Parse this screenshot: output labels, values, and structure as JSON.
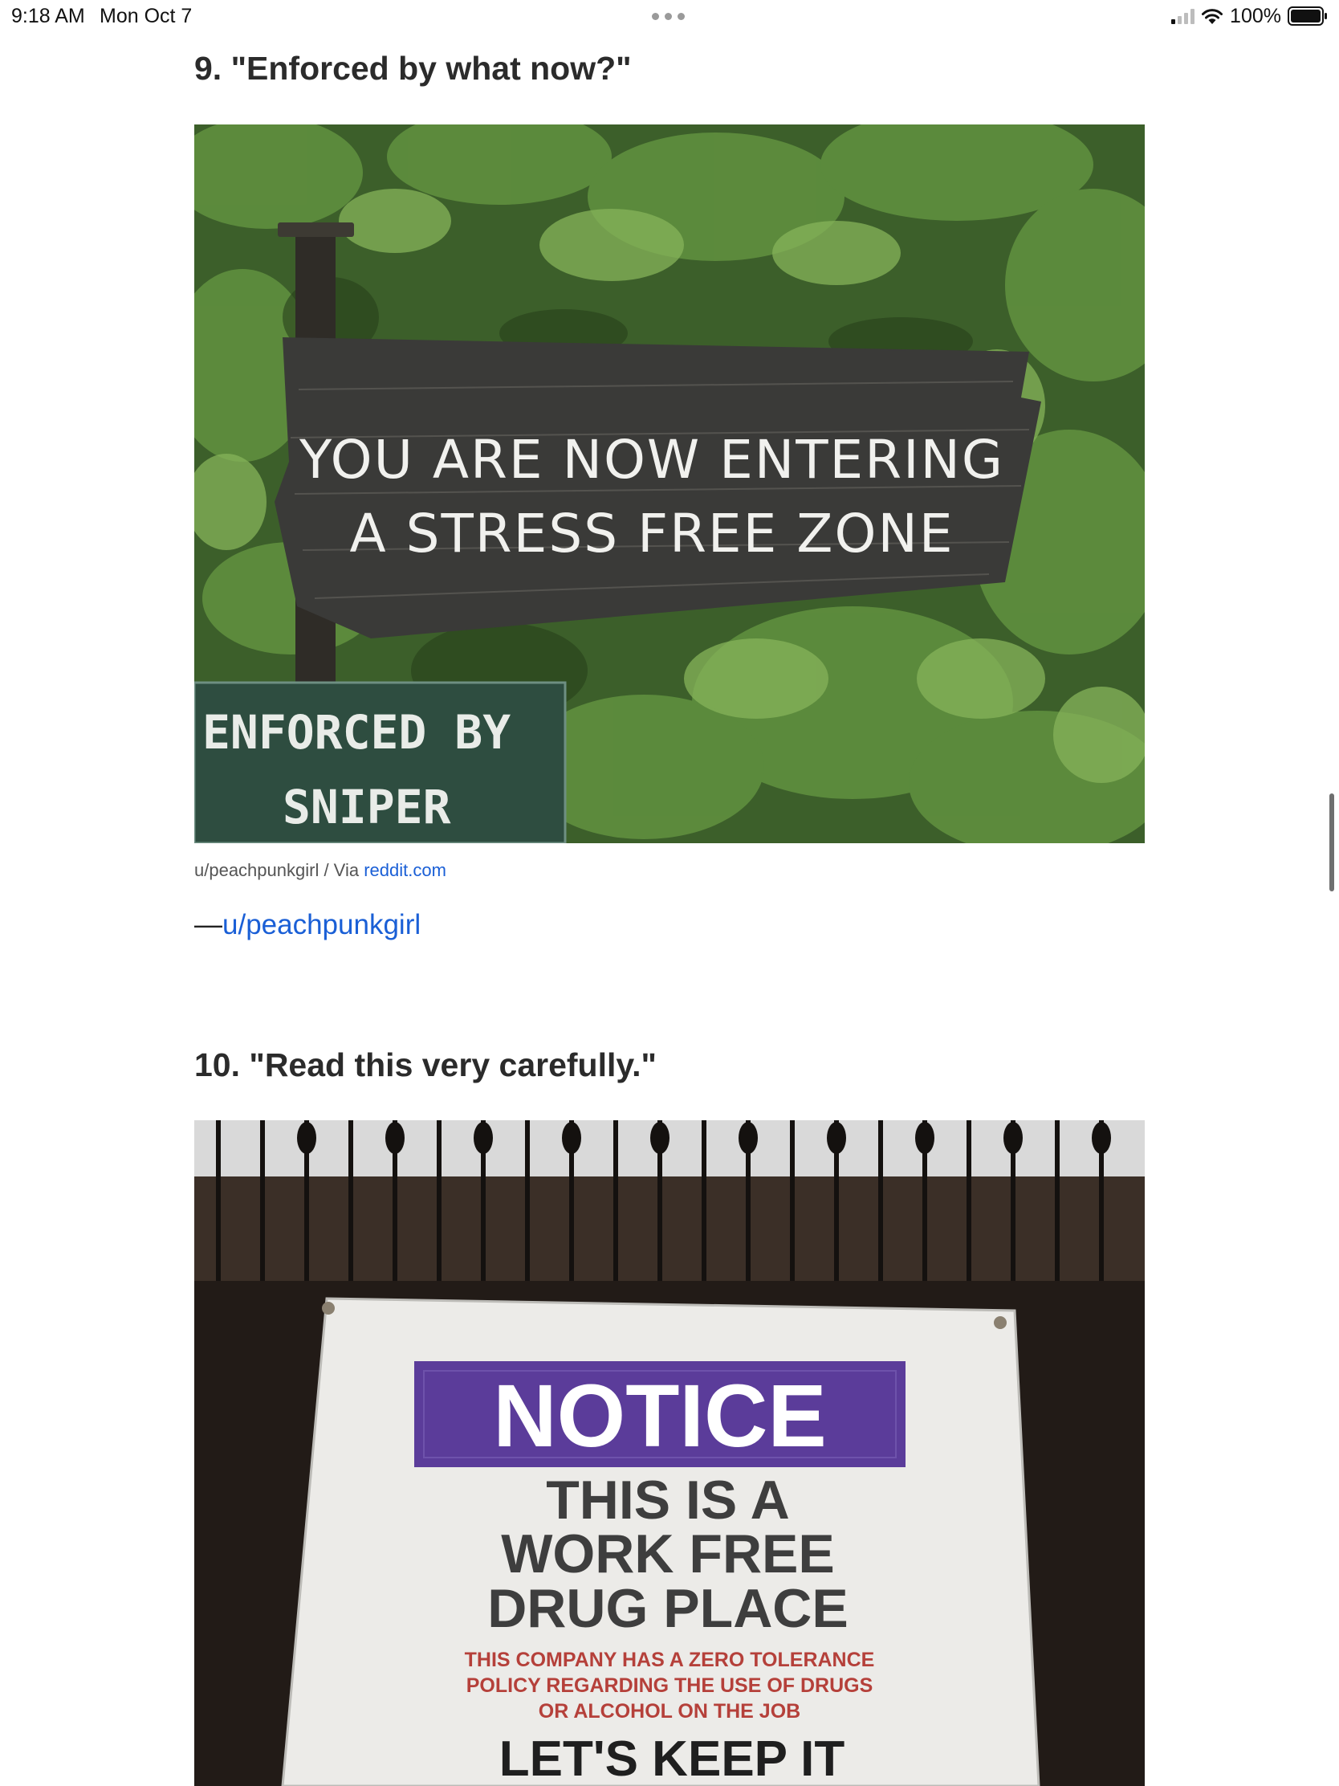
{
  "status_bar": {
    "time": "9:18 AM",
    "date": "Mon Oct 7",
    "battery": "100%",
    "icons": [
      "signal-icon",
      "wifi-icon",
      "battery-icon",
      "more-dots-icon"
    ]
  },
  "items": [
    {
      "title": "9. \"Enforced by what now?\"",
      "photo": {
        "sign_line1": "YOU ARE NOW ENTERING",
        "sign_line2": "A STRESS FREE ZONE",
        "small_sign_line1": "ENFORCED BY",
        "small_sign_line2": "SNIPER"
      },
      "caption_prefix": "u/peachpunkgirl / Via ",
      "caption_link": "reddit.com",
      "credit_dash": "—",
      "credit_link": "u/peachpunkgirl"
    },
    {
      "title": "10. \"Read this very carefully.\"",
      "photo": {
        "banner_header": "NOTICE",
        "banner_line1": "THIS IS A",
        "banner_line2": "WORK FREE",
        "banner_line3": "DRUG PLACE",
        "small_line1": "THIS COMPANY HAS A ZERO TOLERANCE",
        "small_line2": "POLICY REGARDING THE USE OF DRUGS",
        "small_line3": "OR ALCOHOL ON THE JOB",
        "bottom_line": "LET'S KEEP IT"
      }
    }
  ],
  "colors": {
    "link": "#1a5fd6",
    "notice_purple": "#5b3c9a",
    "sign_wood": "#3a3a38",
    "foliage": "#3f6a2c"
  }
}
